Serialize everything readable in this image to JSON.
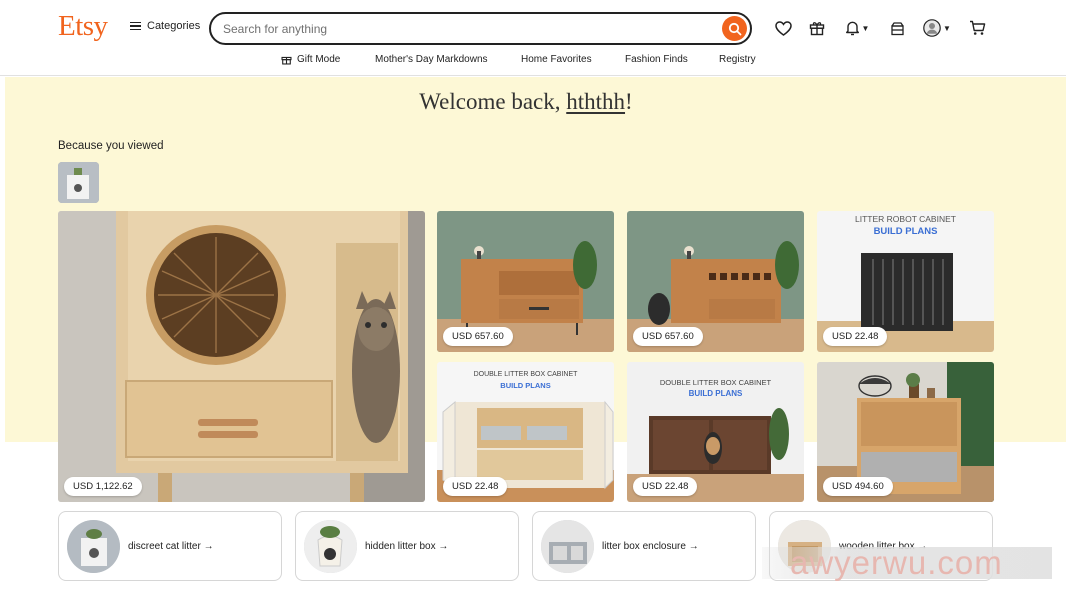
{
  "header": {
    "logo": "Etsy",
    "categories_label": "Categories",
    "search_placeholder": "Search for anything",
    "icons": [
      "heart-icon",
      "gift-icon",
      "bell-icon",
      "registry-icon",
      "avatar",
      "cart-icon"
    ]
  },
  "subnav": {
    "items": [
      "Gift Mode",
      "Mother's Day Markdowns",
      "Home Favorites",
      "Fashion Finds",
      "Registry"
    ]
  },
  "main": {
    "welcome_prefix": "Welcome back, ",
    "username": "hththh",
    "welcome_suffix": "!",
    "because_label": "Because you viewed"
  },
  "listings": [
    {
      "price": "USD 1,122.62"
    },
    {
      "price": "USD 657.60"
    },
    {
      "price": "USD 657.60"
    },
    {
      "price": "USD 22.48",
      "overlay_title": "LITTER ROBOT CABINET",
      "overlay_sub": "BUILD PLANS"
    },
    {
      "price": "USD 22.48",
      "overlay_title": "DOUBLE LITTER BOX CABINET",
      "overlay_sub": "BUILD PLANS"
    },
    {
      "price": "USD 22.48",
      "overlay_title": "DOUBLE LITTER BOX CABINET",
      "overlay_sub": "BUILD PLANS"
    },
    {
      "price": "USD 494.60"
    }
  ],
  "searches": [
    {
      "label": "discreet cat litter →"
    },
    {
      "label": "hidden litter box →"
    },
    {
      "label": "litter box enclosure →"
    },
    {
      "label": "wooden litter box →"
    }
  ],
  "watermark": "awyerwu.com",
  "colors": {
    "accent": "#f1641e",
    "band": "#fdf8d6",
    "plans_blue": "#3b6fd4"
  }
}
